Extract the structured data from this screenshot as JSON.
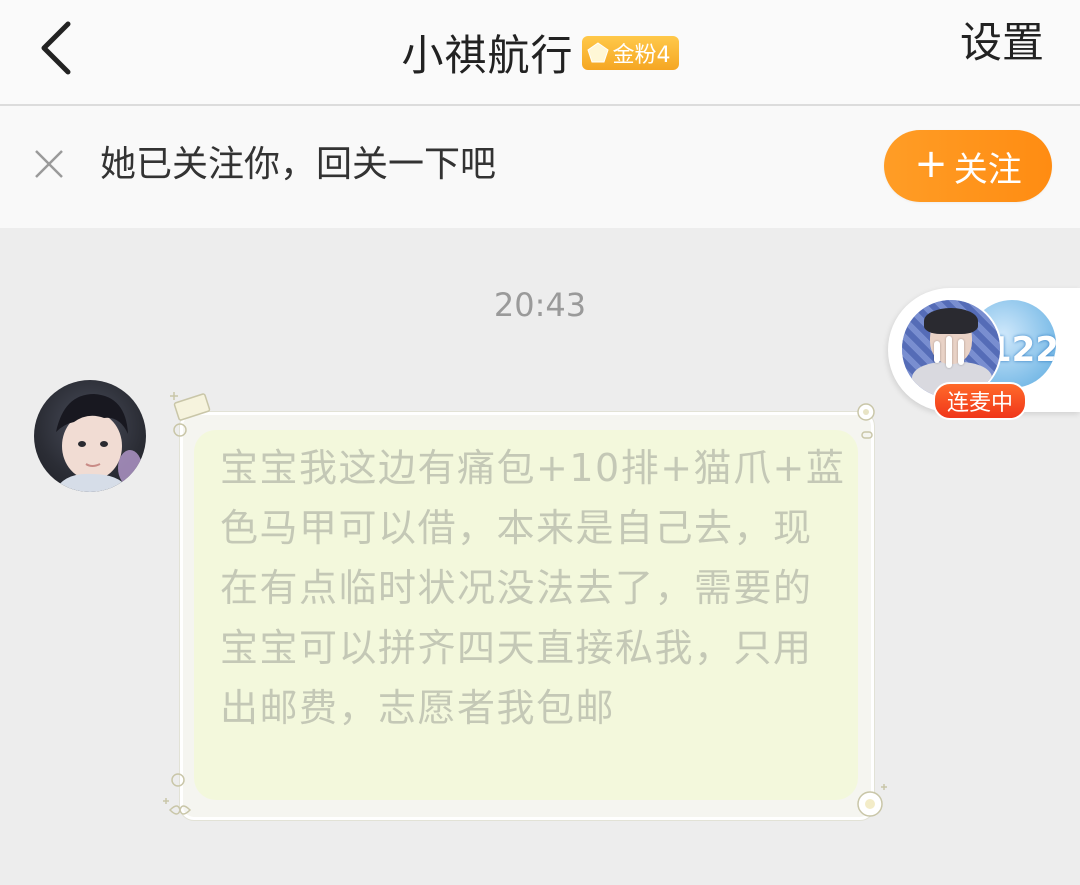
{
  "header": {
    "title": "小祺航行",
    "badge_label": "金粉4",
    "settings_label": "设置"
  },
  "follow_bar": {
    "text": "她已关注你，回关一下吧",
    "button_label": "关注",
    "button_plus": "+"
  },
  "chat": {
    "timestamp": "20:43",
    "message": "宝宝我这边有痛包+10排+猫爪+蓝色马甲可以借，本来是自己去，现在有点临时状况没法去了，需要的宝宝可以拼齐四天直接私我，只用出邮费，志愿者我包邮"
  },
  "live_widget": {
    "label": "连麦中",
    "number_text": "122"
  },
  "colors": {
    "accent_orange": "#ff9124",
    "badge_gold": "#f5a623",
    "live_red": "#f0361a",
    "bubble_bg": "#f3f8dc"
  }
}
